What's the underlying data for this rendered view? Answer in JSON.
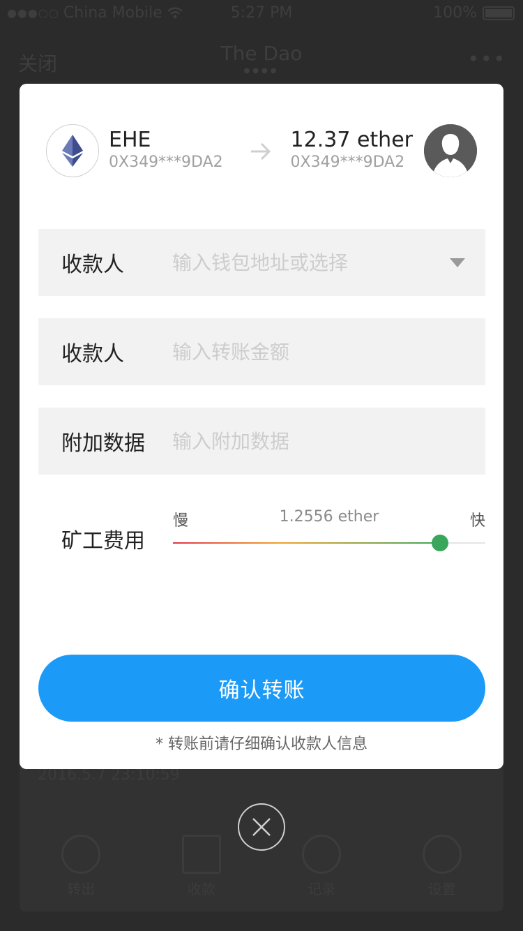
{
  "status_bar": {
    "carrier": "China Mobile",
    "time": "5:27 PM",
    "battery": "100%"
  },
  "nav": {
    "close": "关闭",
    "title": "The Dao",
    "more": "•••"
  },
  "background": {
    "date": "2016.5.7  23:10:59",
    "actions": [
      {
        "label": "转出"
      },
      {
        "label": "收款"
      },
      {
        "label": "记录"
      },
      {
        "label": "设置"
      }
    ]
  },
  "transfer": {
    "sender": {
      "name": "EHE",
      "address": "0X349***9DA2",
      "icon": "ethereum-icon"
    },
    "receiver": {
      "amount": "12.37 ether",
      "address": "0X349***9DA2",
      "icon": "user-avatar-icon"
    },
    "arrow_icon": "arrow-right-icon",
    "fields": {
      "payee": {
        "label": "收款人",
        "placeholder": "输入钱包地址或选择",
        "value": ""
      },
      "amount": {
        "label": "收款人",
        "placeholder": "输入转账金额",
        "value": ""
      },
      "extra": {
        "label": "附加数据",
        "placeholder": "输入附加数据",
        "value": ""
      }
    },
    "fee": {
      "label": "矿工费用",
      "slow": "慢",
      "fast": "快",
      "value": "1.2556 ether",
      "level_fraction": 0.855
    },
    "confirm_label": "确认转账",
    "hint": "* 转账前请仔细确认收款人信息"
  },
  "colors": {
    "primary": "#1b9bf7",
    "slider_thumb": "#3aa65c",
    "overlay": "#2b2b2b"
  }
}
